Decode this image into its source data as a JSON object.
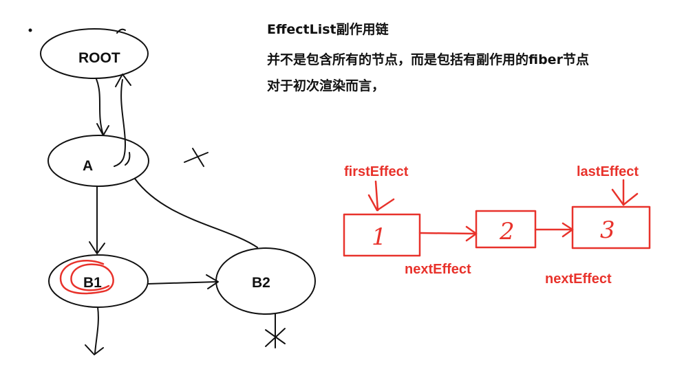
{
  "notes": {
    "title": "EffectList副作用链",
    "line1": "并不是包含所有的节点，而是包括有副作用的fiber节点",
    "line2": "对于初次渲染而言，"
  },
  "tree": {
    "root": "ROOT",
    "a": "A",
    "b1": "B1",
    "b2": "B2"
  },
  "effect_list": {
    "first_label": "firstEffect",
    "last_label": "lastEffect",
    "next_label_1": "nextEffect",
    "next_label_2": "nextEffect",
    "box1": "1",
    "box2": "2",
    "box3": "3"
  },
  "colors": {
    "ink": "#111111",
    "marker_red": "#e8322b"
  }
}
